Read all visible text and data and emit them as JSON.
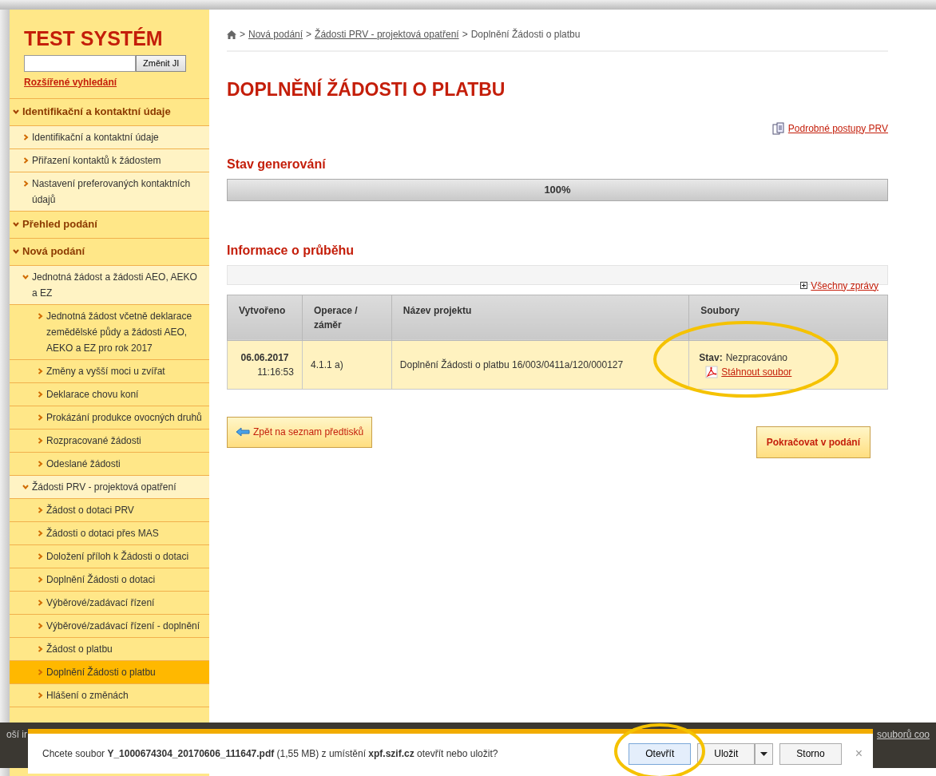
{
  "sidebar": {
    "title": "TEST SYSTÉM",
    "search": {
      "button": "Změnit JI"
    },
    "advanced_search": "Rozšířené vyhledání",
    "menu": [
      {
        "label": "Identifikační a kontaktní údaje",
        "expanded": true,
        "selected": false,
        "children": [
          {
            "label": "Identifikační a kontaktní údaje",
            "expanded": false,
            "selected": false
          },
          {
            "label": "Přiřazení kontaktů k žádostem",
            "expanded": false,
            "selected": false
          },
          {
            "label": "Nastavení preferovaných kontaktních údajů",
            "expanded": false,
            "selected": false
          }
        ]
      },
      {
        "label": "Přehled podání",
        "expanded": true,
        "selected": false
      },
      {
        "label": "Nová podání",
        "expanded": true,
        "selected": false,
        "children": [
          {
            "label": "Jednotná žádost a žádosti AEO, AEKO a EZ",
            "expanded": true,
            "selected": false,
            "children": [
              {
                "label": "Jednotná žádost včetně deklarace zemědělské půdy a žádosti AEO, AEKO a EZ pro rok 2017",
                "expanded": false,
                "selected": false
              },
              {
                "label": "Změny a vyšší moci u zvířat",
                "expanded": false,
                "selected": false
              },
              {
                "label": "Deklarace chovu koní",
                "expanded": false,
                "selected": false
              },
              {
                "label": "Prokázání produkce ovocných druhů",
                "expanded": false,
                "selected": false
              },
              {
                "label": "Rozpracované žádosti",
                "expanded": false,
                "selected": false
              },
              {
                "label": "Odeslané žádosti",
                "expanded": false,
                "selected": false
              }
            ]
          },
          {
            "label": "Žádosti PRV - projektová opatření",
            "expanded": true,
            "selected": false,
            "children": [
              {
                "label": "Žádost o dotaci PRV",
                "expanded": false,
                "selected": false
              },
              {
                "label": "Žádosti o dotaci přes MAS",
                "expanded": false,
                "selected": false
              },
              {
                "label": "Doložení příloh k Žádosti o dotaci",
                "expanded": false,
                "selected": false
              },
              {
                "label": "Doplnění Žádosti o dotaci",
                "expanded": false,
                "selected": false
              },
              {
                "label": "Výběrové/zadávací řízení",
                "expanded": false,
                "selected": false
              },
              {
                "label": "Výběrové/zadávací řízení - doplnění",
                "expanded": false,
                "selected": false
              },
              {
                "label": "Žádost o platbu",
                "expanded": false,
                "selected": false
              },
              {
                "label": "Doplnění Žádosti o platbu",
                "expanded": false,
                "selected": true
              },
              {
                "label": "Hlášení o změnách",
                "expanded": false,
                "selected": false
              }
            ]
          }
        ]
      }
    ]
  },
  "breadcrumb": {
    "separator": ">",
    "links": [
      "Nová podání",
      "Žádosti PRV - projektová opatření"
    ],
    "current": "Doplnění Žádosti o platbu"
  },
  "page_title": "DOPLNĚNÍ ŽÁDOSTI O PLATBU",
  "help_link": "Podrobné postupy PRV",
  "generation": {
    "heading": "Stav generování",
    "level": 1.0,
    "reading": "100%"
  },
  "progress_info": {
    "heading": "Informace o průběhu",
    "all_messages": "Všechny zprávy"
  },
  "table": {
    "columns": [
      "Vytvořeno",
      "Operace / záměr",
      "Název projektu",
      "Soubory"
    ],
    "rows": [
      {
        "date": "06.06.2017",
        "time": "11:16:53",
        "operation": "4.1.1 a)",
        "project": "Doplnění Žádosti o platbu 16/003/0411a/120/000127",
        "status_label": "Stav:",
        "status": "Nezpracováno",
        "download": "Stáhnout soubor"
      }
    ]
  },
  "buttons": {
    "back": "Zpět na seznam předtisků",
    "continue": "Pokračovat v podání"
  },
  "cookie_bar": {
    "text_start": "oší ir",
    "text_end": "souborů coo"
  },
  "download_bar": {
    "message": "Chcete soubor **Y_1000674304_20170606_111647.pdf** (1,55 MB) z umístění **xpf.szif.cz** otevřít nebo uložit?",
    "open": "Otevřít",
    "save": "Uložit",
    "cancel": "Storno",
    "close": "×"
  }
}
